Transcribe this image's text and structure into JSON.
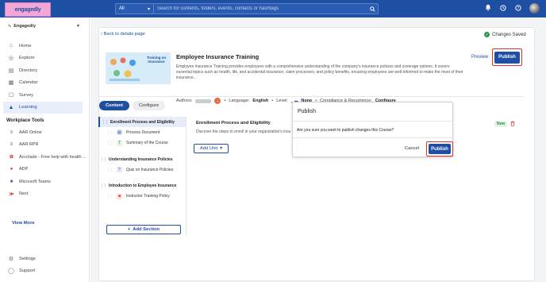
{
  "brand": {
    "logo_text": "engagedly"
  },
  "search": {
    "scope": "All",
    "placeholder": "Search for contents, folders, events, contacts or hashtags"
  },
  "sidebar": {
    "org_name": "Engagedly",
    "items": [
      {
        "label": "Home",
        "icon": "home-icon"
      },
      {
        "label": "Explore",
        "icon": "compass-icon"
      },
      {
        "label": "Directory",
        "icon": "directory-icon"
      },
      {
        "label": "Calendar",
        "icon": "calendar-icon"
      },
      {
        "label": "Survey",
        "icon": "survey-icon"
      },
      {
        "label": "Learning",
        "icon": "learning-icon",
        "active": true
      }
    ],
    "tools_title": "Workplace Tools",
    "tools": [
      {
        "label": "AAR Online",
        "icon": "aar-icon"
      },
      {
        "label": "AAR RPR",
        "icon": "aar-rpr-icon"
      },
      {
        "label": "Accolade - Free help with health ...",
        "icon": "accolade-icon"
      },
      {
        "label": "ADP",
        "icon": "adp-icon"
      },
      {
        "label": "Microsoft Teams",
        "icon": "teams-icon"
      },
      {
        "label": "Next",
        "icon": "next-icon"
      }
    ],
    "view_more": "View More",
    "bottom": [
      {
        "label": "Settings",
        "icon": "gear-icon"
      },
      {
        "label": "Support",
        "icon": "support-icon"
      }
    ]
  },
  "main": {
    "back_link": "Back to details page",
    "status": "Changes Saved",
    "course": {
      "thumb_title": "Training on Insurance",
      "title": "Employee Insurance Training",
      "description": "Employee Insurance Training provides employees with a comprehensive understanding of the company's insurance policies and coverage options. It covers essential topics such as health, life, and accidental insurance; claim processes; and policy benefits, ensuring employees are well-informed to make the most of their insurance...",
      "authors_label": "Authors:",
      "language_label": "Language:",
      "language": "English",
      "level_label": "Level:",
      "level": "None",
      "compliance_label": "Compliance & Recurrence:",
      "compliance": "Configure"
    },
    "preview": "Preview",
    "publish": "Publish",
    "tabs": [
      "Content",
      "Configure"
    ],
    "outline": {
      "sections": [
        {
          "title": "Enrollment Process and Eligibility",
          "items": [
            "Process Document",
            "Summary of the Course"
          ]
        },
        {
          "title": "Understanding Insurance Policies",
          "items": [
            "Quiz on Insurance Policies"
          ]
        },
        {
          "title": "Introduction to Employee Insurance",
          "items": [
            "Instructor Training Policy"
          ]
        }
      ],
      "add_section": "Add Section"
    },
    "detail": {
      "title": "Enrollment Process and Eligibility",
      "description": "Discover the steps to enroll in your organization's insu",
      "add_unit": "Add Unit",
      "badge": "New"
    }
  },
  "modal": {
    "title": "Publish",
    "message": "Are you sure you want to publish changes this Course?",
    "cancel": "Cancel",
    "confirm": "Publish"
  },
  "colors": {
    "brand": "#1f4fa3",
    "highlight": "#d7362c",
    "success": "#2e9b4a"
  }
}
